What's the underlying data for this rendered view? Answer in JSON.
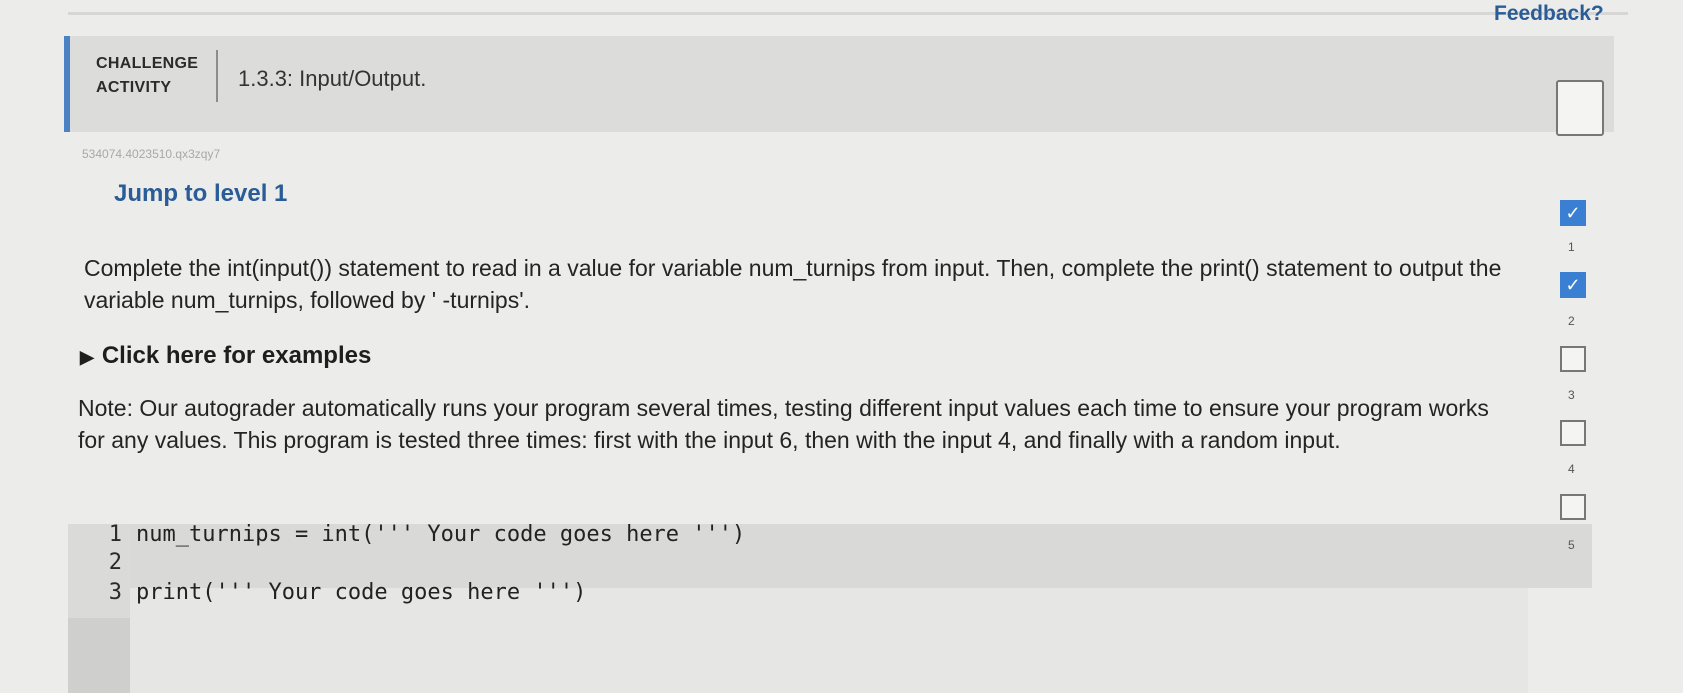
{
  "feedback_link": "Feedback?",
  "header": {
    "label_line1": "CHALLENGE",
    "label_line2": "ACTIVITY",
    "title": "1.3.3: Input/Output."
  },
  "activity_id": "534074.4023510.qx3zqy7",
  "jump_link": "Jump to level 1",
  "description": "Complete the int(input()) statement to read in a value for variable num_turnips from input. Then, complete the print() statement to output the variable num_turnips, followed by ' -turnips'.",
  "examples_toggle": "Click here for examples",
  "note": "Note: Our autograder automatically runs your program several times, testing different input values each time to ensure your program works for any values. This program is tested three times: first with the input 6, then with the input 4, and finally with a random input.",
  "code": {
    "lines": [
      {
        "num": "1",
        "text": "num_turnips = int(''' Your code goes here ''')"
      },
      {
        "num": "2",
        "text": ""
      },
      {
        "num": "3",
        "text": "print(''' Your code goes here ''')"
      }
    ]
  },
  "levels": [
    {
      "num": "1",
      "completed": true
    },
    {
      "num": "2",
      "completed": true
    },
    {
      "num": "3",
      "completed": false
    },
    {
      "num": "4",
      "completed": false
    },
    {
      "num": "5",
      "completed": false
    }
  ],
  "check_glyph": "✓",
  "colors": {
    "accent": "#4a82c4",
    "link": "#2a5c97",
    "level_done": "#3a7fd1"
  }
}
